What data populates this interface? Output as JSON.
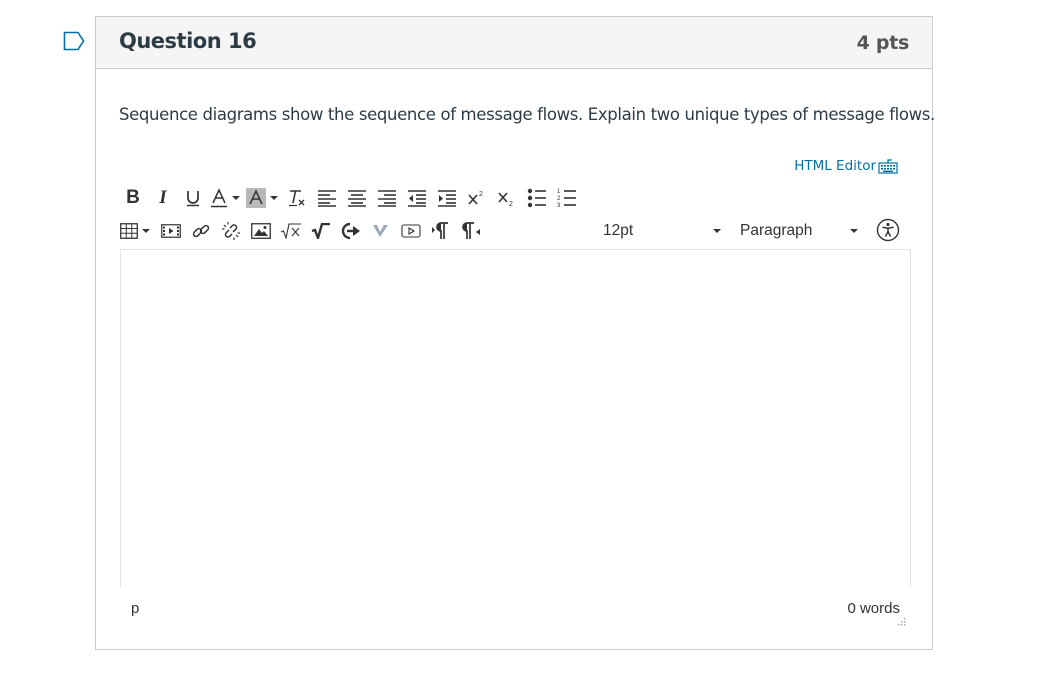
{
  "question": {
    "title": "Question 16",
    "points": "4 pts",
    "text": "Sequence diagrams show the sequence of message flows. Explain two unique types of message flows."
  },
  "editor": {
    "html_editor_label": "HTML Editor",
    "font_size": "12pt",
    "block_format": "Paragraph",
    "status_path": "p",
    "word_count": "0 words",
    "content": ""
  },
  "toolbar_row1": [
    "bold",
    "italic",
    "underline",
    "text-color",
    "background-color",
    "clear-formatting",
    "align-left",
    "align-center",
    "align-right",
    "outdent",
    "indent",
    "superscript",
    "subscript",
    "bullet-list",
    "numbered-list"
  ],
  "toolbar_row2": [
    "table",
    "media",
    "link",
    "unlink",
    "image",
    "equation",
    "math",
    "embed",
    "vimeo",
    "video",
    "ltr",
    "rtl",
    "font-size",
    "block-format",
    "accessibility-checker"
  ],
  "colors": {
    "link": "#0770a3",
    "border": "#c7cdd1",
    "header_bg": "#f5f5f5",
    "flag": "#0770a3"
  }
}
